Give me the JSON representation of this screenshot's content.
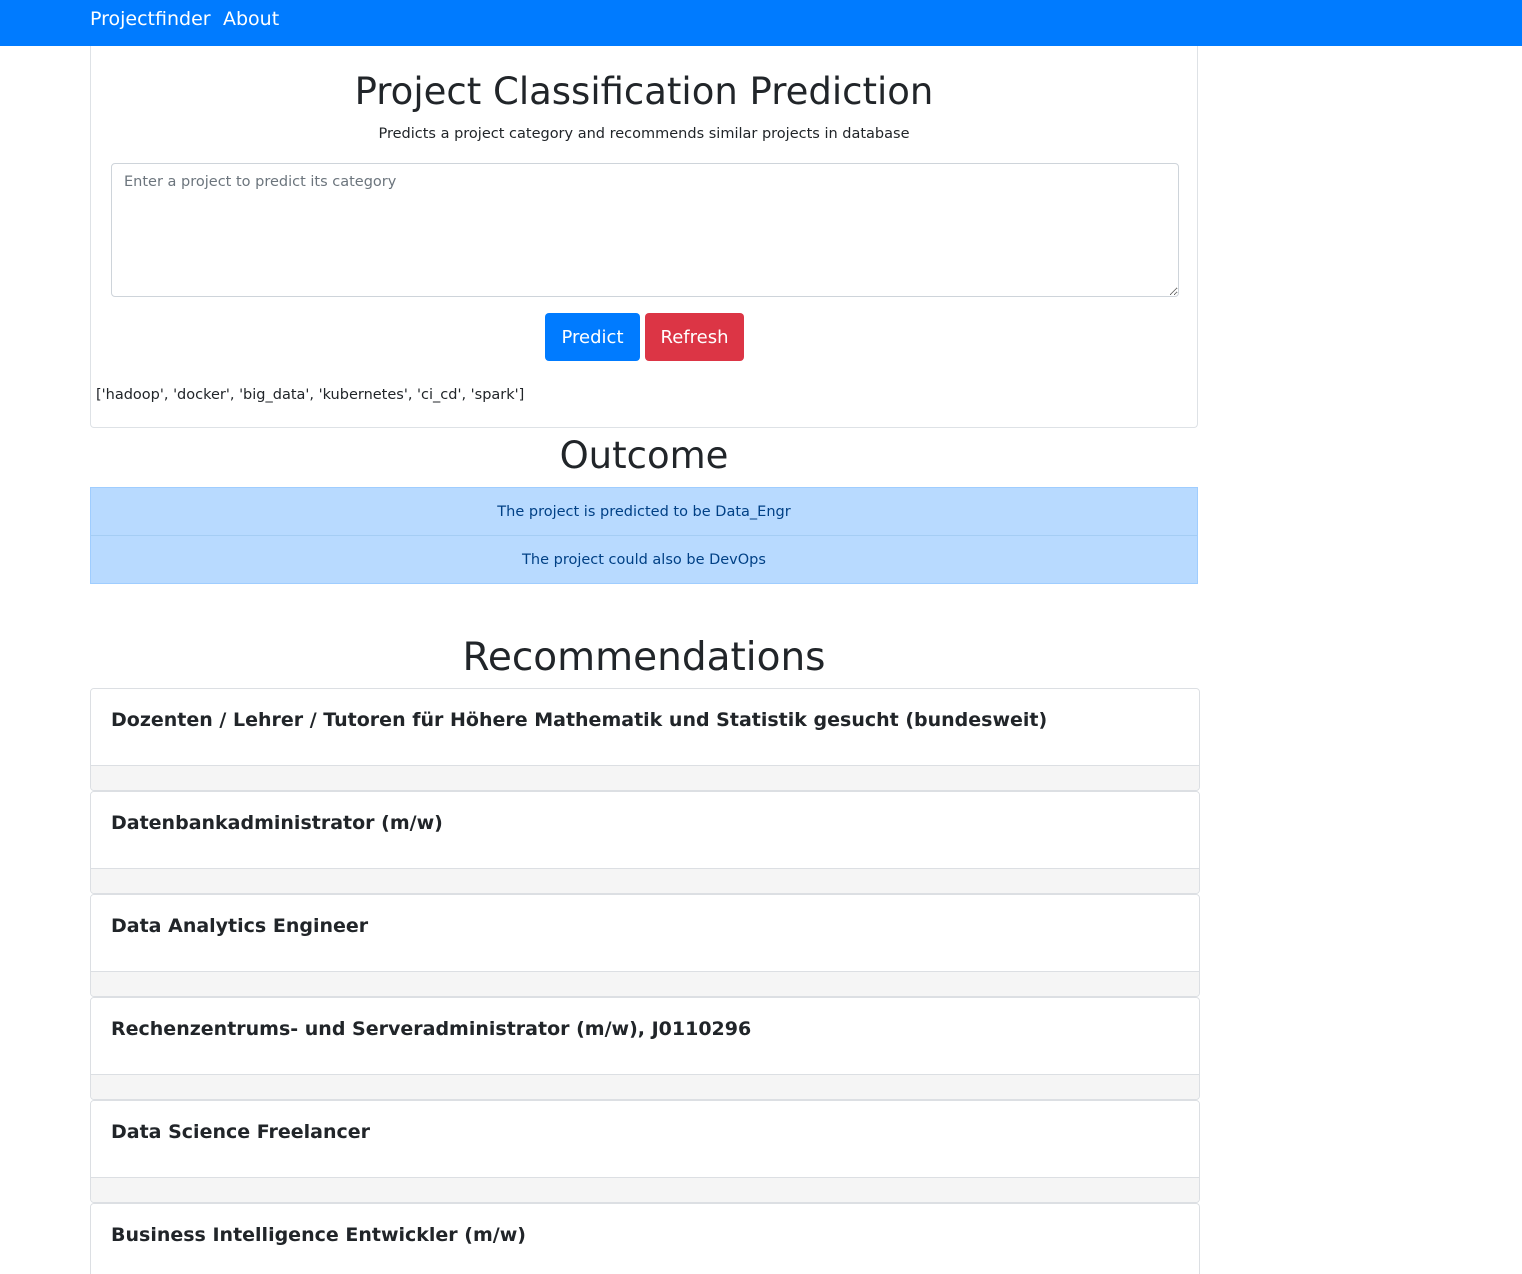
{
  "navbar": {
    "brand": "Projectfinder",
    "links": [
      "About"
    ]
  },
  "form": {
    "title": "Project Classification Prediction",
    "subtitle": "Predicts a project category and recommends similar projects in database",
    "input_placeholder": "Enter a project to predict its category",
    "input_value": "",
    "predict_label": "Predict",
    "refresh_label": "Refresh",
    "keywords": "['hadoop', 'docker', 'big_data', 'kubernetes', 'ci_cd', 'spark']"
  },
  "outcome": {
    "title": "Outcome",
    "primary": "The project is predicted to be Data_Engr",
    "secondary": "The project could also be DevOps"
  },
  "recommendations": {
    "title": "Recommendations",
    "items": [
      "Dozenten / Lehrer / Tutoren für Höhere Mathematik und Statistik gesucht (bundesweit)",
      "Datenbankadministrator (m/w)",
      "Data Analytics Engineer",
      "Rechenzentrums- und Serveradministrator (m/w), J0110296",
      "Data Science Freelancer",
      "Business Intelligence Entwickler (m/w)"
    ]
  },
  "colors": {
    "navbar": "#007bff",
    "predict_button": "#007bff",
    "refresh_button": "#dc3545",
    "alert_background": "#b8daff",
    "alert_text": "#004085"
  }
}
